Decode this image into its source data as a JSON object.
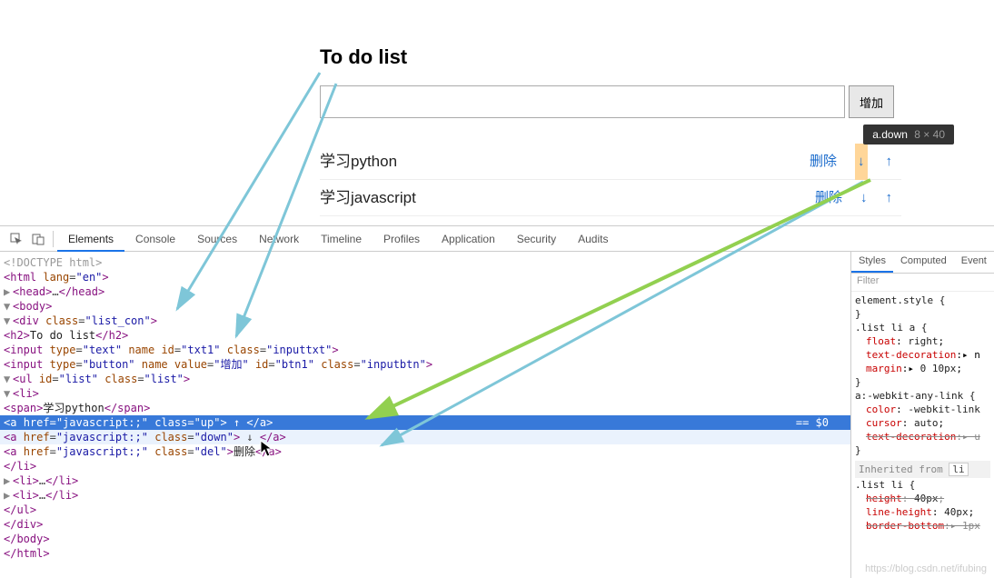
{
  "app": {
    "title": "To do list",
    "input_placeholder": "",
    "add_button": "增加",
    "tooltip_selector": "a.down",
    "tooltip_dims": "8 × 40"
  },
  "items": [
    {
      "text": "学习python",
      "delete": "删除",
      "down": "↓",
      "up": "↑"
    },
    {
      "text": "学习javascript",
      "delete": "删除",
      "down": "↓",
      "up": "↑"
    }
  ],
  "devtools": {
    "tabs": [
      "Elements",
      "Console",
      "Sources",
      "Network",
      "Timeline",
      "Profiles",
      "Application",
      "Security",
      "Audits"
    ],
    "active_tab": "Elements"
  },
  "dom": {
    "doctype": "<!DOCTYPE html>",
    "html_open": "<html lang=\"en\">",
    "head": "<head>…</head>",
    "body_open": "<body>",
    "div_open": "<div class=\"list_con\">",
    "h2": "<h2>To do list</h2>",
    "input1": "<input type=\"text\" name id=\"txt1\" class=\"inputtxt\">",
    "input2": "<input type=\"button\" name value=\"增加\" id=\"btn1\" class=\"inputbtn\">",
    "ul_open": "<ul id=\"list\" class=\"list\">",
    "li_open": "<li>",
    "span_line": "<span>学习python</span>",
    "a_up": "<a href=\"javascript:;\" class=\"up\"> ↑ </a>",
    "a_down": "<a href=\"javascript:;\" class=\"down\"> ↓ </a>",
    "a_del": "<a href=\"javascript:;\" class=\"del\">删除</a>",
    "li_close": "</li>",
    "li2": "<li>…</li>",
    "li3": "<li>…</li>",
    "ul_close": "</ul>",
    "div_close": "</div>",
    "body_close": "</body>",
    "html_close": "</html>",
    "eq": "== $0"
  },
  "styles": {
    "tabs": [
      "Styles",
      "Computed",
      "Event"
    ],
    "filter": "Filter",
    "rules": {
      "element_style": "element.style {",
      "close": "}",
      "list_a_sel": ".list li a {",
      "float": "float: right;",
      "textdec": "text-decoration:▸ n",
      "margin": "margin:▸ 0 10px;",
      "anylink_sel": "a:-webkit-any-link {",
      "color": "color: -webkit-link",
      "cursor": "cursor: auto;",
      "textdec2": "text-decoration:▸ u",
      "inherited": "Inherited from",
      "inherited_tag": "li",
      "list_li_sel": ".list li {",
      "height": "height: 40px;",
      "lineheight": "line-height: 40px;",
      "border": "border-bottom:▸ 1px"
    }
  },
  "watermark": "https://blog.csdn.net/ifubing"
}
